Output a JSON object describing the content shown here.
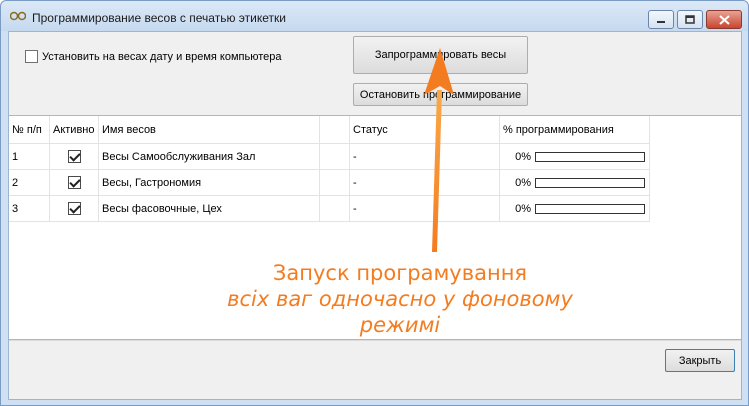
{
  "window": {
    "title": "Программирование весов с печатью этикетки"
  },
  "options": {
    "set_datetime_label": "Установить на весах дату и время компьютера",
    "set_datetime_checked": false
  },
  "toolbar": {
    "program_label": "Запрограммировать весы",
    "stop_label": "Остановить программирование"
  },
  "table": {
    "columns": [
      "№ п/п",
      "Активно",
      "Имя весов",
      "",
      "Статус",
      "% программирования"
    ],
    "rows": [
      {
        "num": "1",
        "active": true,
        "name": "Весы Самообслуживания Зал",
        "status": "-",
        "percent_text": "0%",
        "progress": 0
      },
      {
        "num": "2",
        "active": true,
        "name": "Весы, Гастрономия",
        "status": "-",
        "percent_text": "0%",
        "progress": 0
      },
      {
        "num": "3",
        "active": true,
        "name": "Весы фасовочные, Цех",
        "status": "-",
        "percent_text": "0%",
        "progress": 0
      }
    ]
  },
  "footer": {
    "close_label": "Закрыть"
  },
  "annotation": {
    "line1": "Запуск програмування",
    "line2": "всіх ваг одночасно у фоновому режимі",
    "color": "#f47c20"
  },
  "icons": {
    "app": "scales-icon",
    "minimize": "minimize-icon",
    "maximize": "maximize-icon",
    "close": "close-icon"
  }
}
